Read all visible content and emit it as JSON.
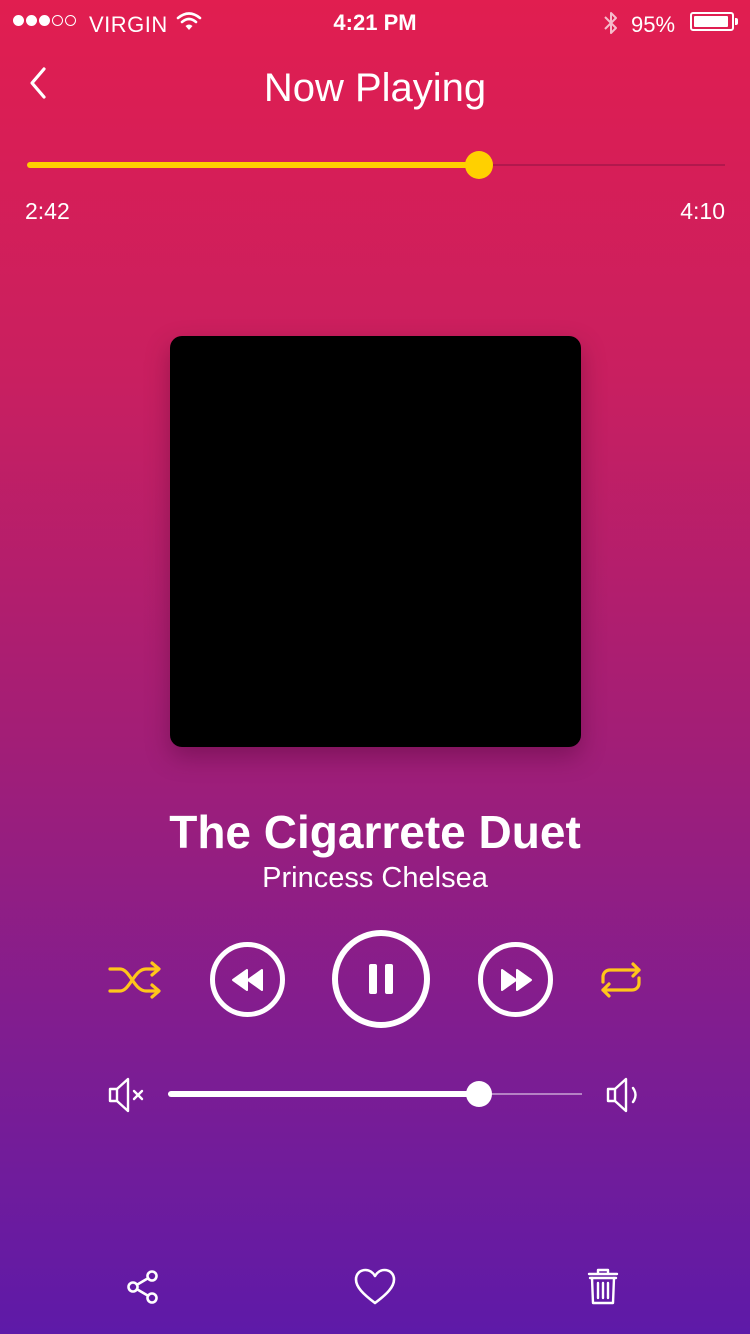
{
  "status_bar": {
    "carrier": "VIRGIN",
    "signal_filled": 3,
    "signal_total": 5,
    "time": "4:21 PM",
    "battery_percent": "95%",
    "battery_level": 0.95,
    "icons": [
      "wifi-icon",
      "bluetooth-icon",
      "battery-icon"
    ]
  },
  "nav": {
    "back_icon": "chevron-left-icon",
    "title": "Now Playing"
  },
  "progress": {
    "elapsed": "2:42",
    "total": "4:10",
    "fraction": 0.648,
    "color": "#ffd000"
  },
  "track": {
    "title": "The Cigarrete Duet",
    "artist": "Princess Chelsea"
  },
  "controls": {
    "icons": [
      "shuffle-icon",
      "rewind-icon",
      "pause-icon",
      "fast-forward-icon",
      "repeat-icon"
    ],
    "accent_color": "#ffc61a"
  },
  "volume": {
    "level": 0.75,
    "icons": [
      "mute-icon",
      "speaker-icon"
    ]
  },
  "actions": {
    "icons": [
      "share-icon",
      "heart-icon",
      "trash-icon"
    ]
  },
  "theme": {
    "gradient_top": "#e11e50",
    "gradient_bottom": "#5e1aa8"
  }
}
